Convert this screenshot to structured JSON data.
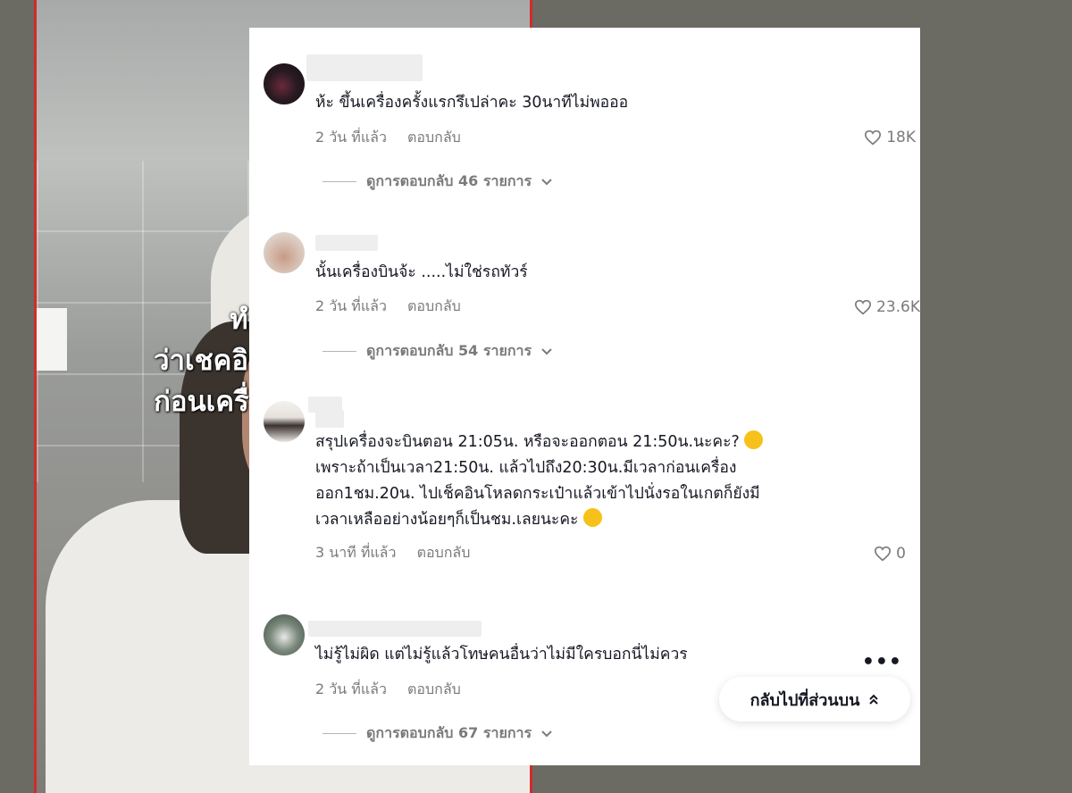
{
  "video": {
    "caption_lines": [
      "ทำไม",
      "ว่าเชคอิน ชิ",
      "ก่อนเครื่องอ"
    ]
  },
  "comments": [
    {
      "avatar": "dark-portrait-avatar",
      "text_lines": [
        "ห้ะ ขึ้นเครื่องครั้งแรกรึเปล่าคะ 30นาทีไม่พอออ"
      ],
      "time": "2 วัน ที่แล้ว",
      "reply_label": "ตอบกลับ",
      "likes": "18K",
      "view_replies": "ดูการตอบกลับ 46 รายการ"
    },
    {
      "avatar": "shirtless-man-avatar",
      "text_lines": [
        "นั้นเครื่องบินจ้ะ .....ไม่ใช่รถทัวร์"
      ],
      "time": "2 วัน ที่แล้ว",
      "reply_label": "ตอบกลับ",
      "likes": "23.6K",
      "view_replies": "ดูการตอบกลับ 54 รายการ"
    },
    {
      "avatar": "standing-girl-avatar",
      "text_lines": [
        "สรุปเครื่องจะบินตอน 21:05น. หรือจะออกตอน 21:50น.นะคะ?",
        "เพราะถ้าเป็นเวลา21:50น. แล้วไปถึง20:30น.มีเวลาก่อนเครื่อง",
        "ออก1ชม.20น. ไปเช็คอินโหลดกระเป๋าแล้วเข้าไปนั่งรอในเกตก็ยังมี",
        "เวลาเหลืออย่างน้อยๆก็เป็นชม.เลยนะคะ"
      ],
      "time": "3 นาที ที่แล้ว",
      "reply_label": "ตอบกลับ",
      "likes": "0"
    },
    {
      "avatar": "pet-photo-avatar",
      "text_lines": [
        "ไม่รู้ไม่ผิด แต่ไม่รู้แล้วโทษคนอื่นว่าไม่มีใครบอกนี่ไม่ควร"
      ],
      "time": "2 วัน ที่แล้ว",
      "reply_label": "ตอบกลับ",
      "view_replies": "ดูการตอบกลับ 67 รายการ"
    }
  ],
  "more_label": "•••",
  "back_to_top": "กลับไปที่ส่วนบน",
  "colors": {
    "text": "#161823",
    "muted": "#7a7a7a",
    "emoji": "#f6c11a",
    "frame_border": "#d22b2b"
  }
}
